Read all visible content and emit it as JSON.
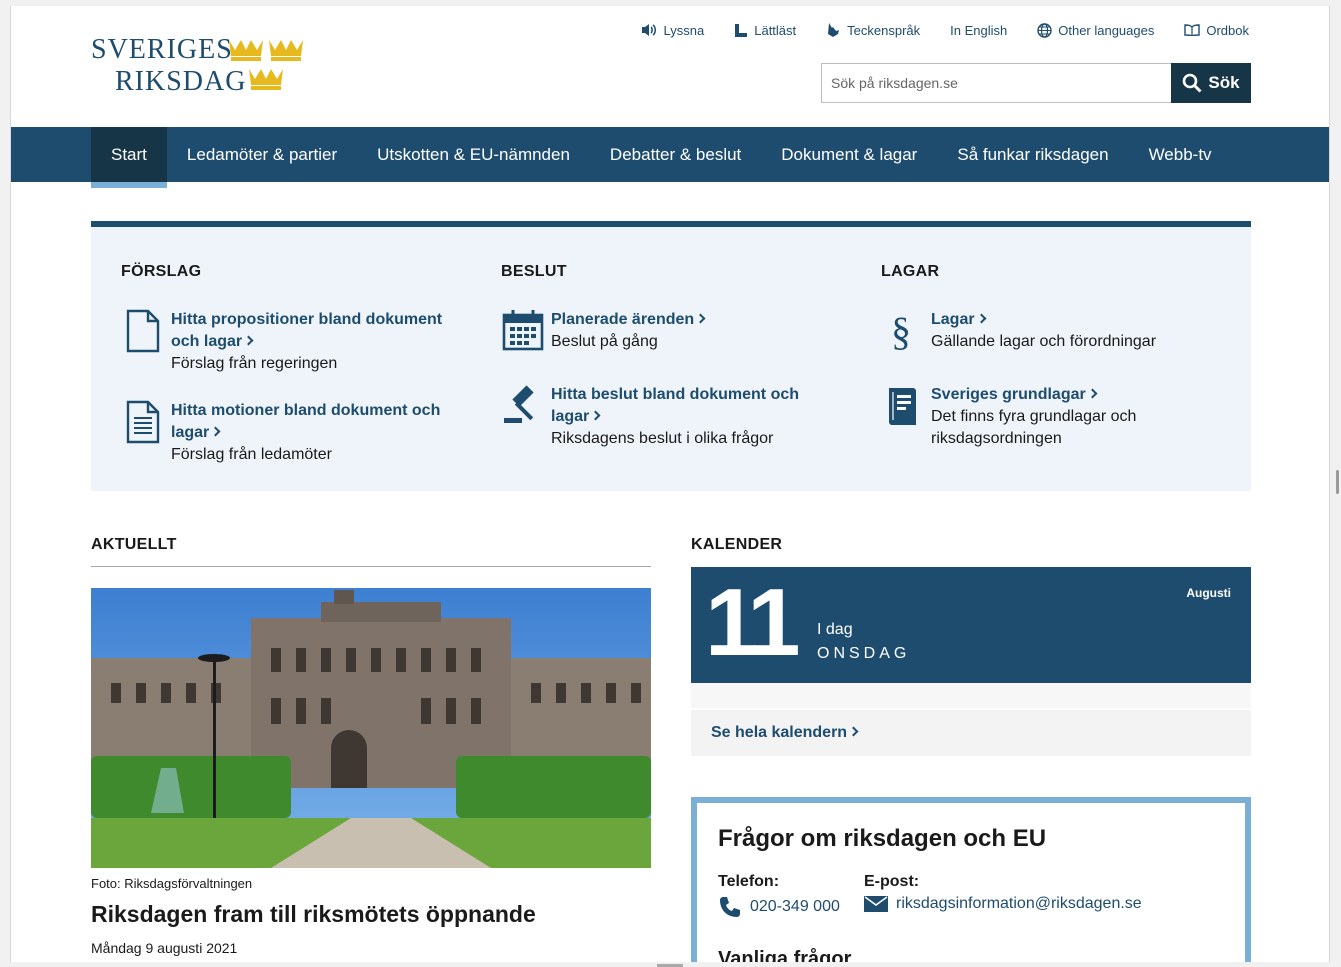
{
  "logo": {
    "line1": "SVERIGES",
    "line2": "RIKSDAG"
  },
  "utility": [
    {
      "label": "Lyssna",
      "icon": "speaker-icon"
    },
    {
      "label": "Lättläst",
      "icon": "easy-read-icon"
    },
    {
      "label": "Teckenspråk",
      "icon": "sign-language-icon"
    },
    {
      "label": "In English",
      "icon": ""
    },
    {
      "label": "Other languages",
      "icon": "globe-icon"
    },
    {
      "label": "Ordbok",
      "icon": "book-icon"
    }
  ],
  "search": {
    "placeholder": "Sök på riksdagen.se",
    "button": "Sök"
  },
  "nav": {
    "items": [
      "Start",
      "Ledamöter & partier",
      "Utskotten & EU-nämnden",
      "Debatter & beslut",
      "Dokument & lagar",
      "Så funkar riksdagen",
      "Webb-tv"
    ],
    "active": "Start"
  },
  "panel": {
    "forslag": {
      "heading": "FÖRSLAG",
      "entries": [
        {
          "link": "Hitta propositioner bland dokument och lagar",
          "sub": "Förslag från regeringen",
          "icon": "document-icon"
        },
        {
          "link": "Hitta motioner bland dokument och lagar",
          "sub": "Förslag från ledamöter",
          "icon": "text-document-icon"
        }
      ]
    },
    "beslut": {
      "heading": "BESLUT",
      "entries": [
        {
          "link": "Planerade ärenden",
          "sub": "Beslut på gång",
          "icon": "calendar-icon"
        },
        {
          "link": "Hitta beslut bland dokument och lagar",
          "sub": "Riksdagens beslut i olika frågor",
          "icon": "gavel-icon"
        }
      ]
    },
    "lagar": {
      "heading": "LAGAR",
      "entries": [
        {
          "link": "Lagar",
          "sub": "Gällande lagar och förordningar",
          "icon": "paragraph-icon"
        },
        {
          "link": "Sveriges grundlagar",
          "sub": "Det finns fyra grundlagar och riksdagsordningen",
          "icon": "law-book-icon"
        }
      ]
    }
  },
  "aktuellt": {
    "heading": "AKTUELLT",
    "caption": "Foto: Riksdagsförvaltningen",
    "title": "Riksdagen fram till riksmötets öppnande",
    "date": "Måndag 9 augusti 2021"
  },
  "kalender": {
    "heading": "KALENDER",
    "day": "11",
    "today": "I dag",
    "weekday": "ONSDAG",
    "month": "Augusti",
    "link": "Se hela kalendern"
  },
  "contact": {
    "title": "Frågor om riksdagen och EU",
    "phone_label": "Telefon:",
    "phone": "020-349 000",
    "email_label": "E-post:",
    "email": "riksdagsinformation@riksdagen.se",
    "more": "Vanliga frågor"
  },
  "colors": {
    "brand": "#1e4c6e",
    "dark": "#163648",
    "accent": "#7ab0d6",
    "gold": "#e6b91e"
  }
}
